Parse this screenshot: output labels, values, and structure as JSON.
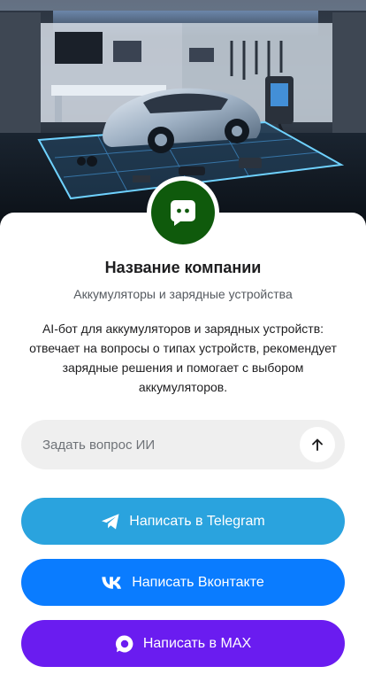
{
  "company": {
    "name": "Название компании",
    "tagline": "Аккумуляторы и зарядные устройства",
    "description": "AI-бот для аккумуляторов и зарядных устройств: отвечает на вопросы о типах устройств, рекомендует зарядные решения и помогает с выбором аккумуляторов.",
    "avatar_color": "#0f5a0c",
    "avatar_icon": "chat-bot-icon"
  },
  "ask": {
    "placeholder": "Задать вопрос ИИ",
    "value": "",
    "send_icon": "arrow-up-icon"
  },
  "buttons": {
    "telegram": {
      "label": "Написать в Telegram",
      "icon": "telegram-icon",
      "color": "#2aa3de"
    },
    "vk": {
      "label": "Написать Вконтакте",
      "icon": "vk-icon",
      "color": "#0a7cff"
    },
    "max": {
      "label": "Написать в MAX",
      "icon": "max-icon",
      "color": "#6a1cf0"
    }
  }
}
